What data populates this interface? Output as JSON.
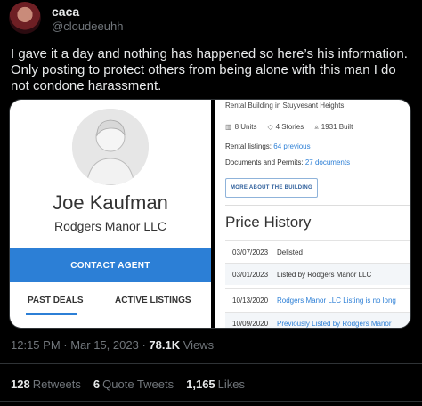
{
  "author": {
    "name": "caca",
    "handle": "@cloudeeuhh"
  },
  "tweet": {
    "text": "I gave it a day and nothing has happened so here’s his information. Only posting to protect others from being alone with this man I do not condone harassment."
  },
  "media": {
    "left": {
      "agent_name": "Joe Kaufman",
      "company": "Rodgers Manor LLC",
      "contact_button": "CONTACT AGENT",
      "tabs": [
        "PAST DEALS",
        "ACTIVE LISTINGS"
      ]
    },
    "right": {
      "subtitle": "Rental Building in Stuyvesant Heights",
      "stats": {
        "units": "8 Units",
        "stories": "4 Stories",
        "built": "1931 Built"
      },
      "rental_listings_label": "Rental listings:",
      "rental_listings_link": "64 previous",
      "docs_label": "Documents and Permits:",
      "docs_link": "27 documents",
      "more_button": "MORE ABOUT THE BUILDING",
      "price_history_title": "Price History",
      "price_history": [
        {
          "date": "03/07/2023",
          "event": "Delisted"
        },
        {
          "date": "03/01/2023",
          "event": "Listed by Rodgers Manor LLC"
        },
        {
          "date": "10/13/2020",
          "event": "Rodgers Manor LLC Listing is no long"
        },
        {
          "date": "10/09/2020",
          "event": "Previously Listed by Rodgers Manor"
        }
      ]
    }
  },
  "meta": {
    "time": "12:15 PM",
    "date": "Mar 15, 2023",
    "views_count": "78.1K",
    "views_label": "Views"
  },
  "engagement": {
    "retweets": "128",
    "retweets_label": "Retweets",
    "quotes": "6",
    "quotes_label": "Quote Tweets",
    "likes": "1,165",
    "likes_label": "Likes"
  },
  "colors": {
    "accent": "#2c7fd6",
    "background": "#000000",
    "muted": "#71767b"
  }
}
